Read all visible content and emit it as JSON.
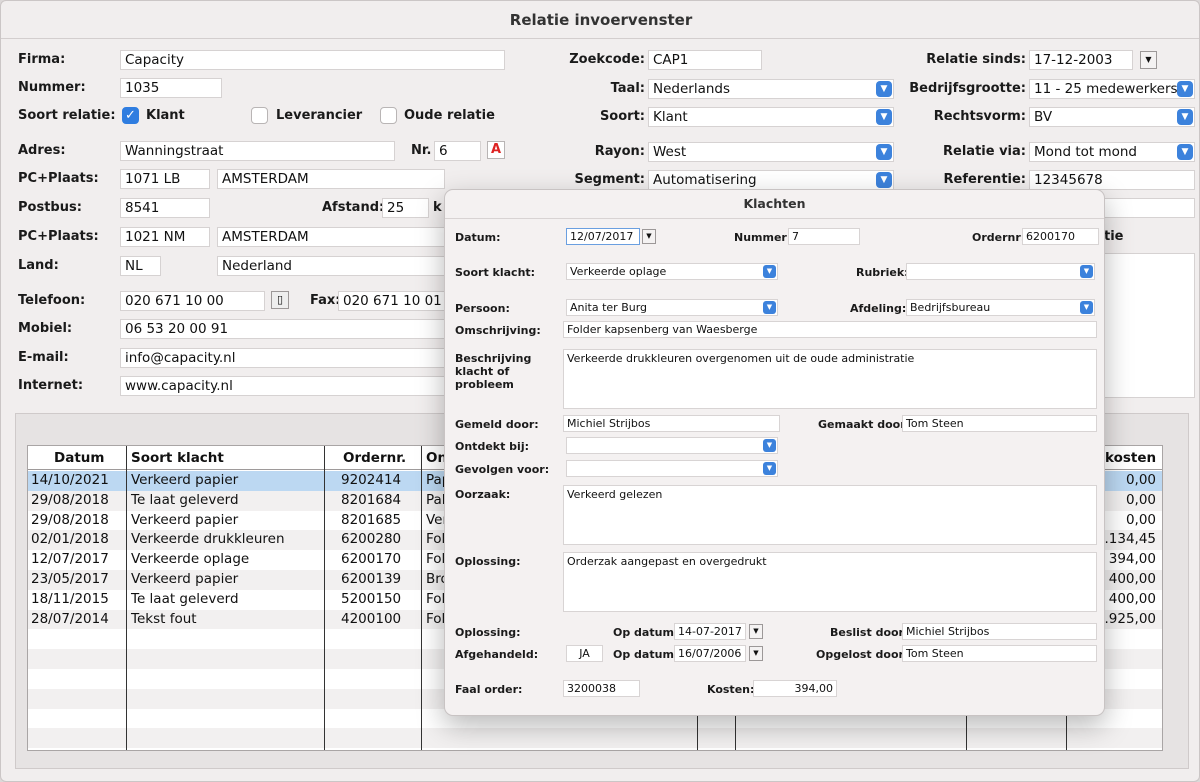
{
  "window": {
    "title": "Relatie invoervenster"
  },
  "form": {
    "firma_label": "Firma:",
    "firma": "Capacity",
    "nummer_label": "Nummer:",
    "nummer": "1035",
    "soort_relatie_label": "Soort relatie:",
    "klant_label": "Klant",
    "leverancier_label": "Leverancier",
    "oude_relatie_label": "Oude relatie",
    "adres_label": "Adres:",
    "adres": "Wanningstraat",
    "nr_label": "Nr.",
    "nr": "6",
    "pc_plaats_label": "PC+Plaats:",
    "pc1": "1071 LB",
    "plaats1": "AMSTERDAM",
    "postbus_label": "Postbus:",
    "postbus": "8541",
    "afstand_label": "Afstand:",
    "afstand": "25",
    "afstand_unit": "k",
    "pc2": "1021 NM",
    "plaats2": "AMSTERDAM",
    "land_label": "Land:",
    "land_code": "NL",
    "land": "Nederland",
    "telefoon_label": "Telefoon:",
    "telefoon": "020 671 10 00",
    "fax_label": "Fax:",
    "fax": "020 671 10 01",
    "mobiel_label": "Mobiel:",
    "mobiel": "06 53 20 00 91",
    "email_label": "E-mail:",
    "email": "info@capacity.nl",
    "internet_label": "Internet:",
    "internet": "www.capacity.nl",
    "zoekcode_label": "Zoekcode:",
    "zoekcode": "CAP1",
    "taal_label": "Taal:",
    "taal": "Nederlands",
    "soort_label": "Soort:",
    "soort": "Klant",
    "rayon_label": "Rayon:",
    "rayon": "West",
    "segment_label": "Segment:",
    "segment": "Automatisering",
    "relatie_sinds_label": "Relatie sinds:",
    "relatie_sinds": "17-12-2003",
    "bedrijfsgrootte_label": "Bedrijfsgrootte:",
    "bedrijfsgrootte": "11 - 25 medewerkers",
    "rechtsvorm_label": "Rechtsvorm:",
    "rechtsvorm": "BV",
    "relatie_via_label": "Relatie via:",
    "relatie_via": "Mond tot mond",
    "referentie_label": "Referentie:",
    "referentie": "12345678",
    "partial_label": "tie"
  },
  "table": {
    "headers": {
      "datum": "Datum",
      "soort": "Soort klacht",
      "ordernr": "Ordernr.",
      "on": "On",
      "kosten": "kosten"
    },
    "rows": [
      {
        "datum": "14/10/2021",
        "soort": "Verkeerd papier",
        "ordernr": "9202414",
        "on": "Pap",
        "kosten": "0,00"
      },
      {
        "datum": "29/08/2018",
        "soort": "Te laat geleverd",
        "ordernr": "8201684",
        "on": "Pal",
        "kosten": "0,00"
      },
      {
        "datum": "29/08/2018",
        "soort": "Verkeerd papier",
        "ordernr": "8201685",
        "on": "Ver",
        "kosten": "0,00"
      },
      {
        "datum": "02/01/2018",
        "soort": "Verkeerde drukkleuren",
        "ordernr": "6200280",
        "on": "Fol",
        "kosten": ".134,45"
      },
      {
        "datum": "12/07/2017",
        "soort": "Verkeerde oplage",
        "ordernr": "6200170",
        "on": "Fol",
        "kosten": "394,00"
      },
      {
        "datum": "23/05/2017",
        "soort": "Verkeerd papier",
        "ordernr": "6200139",
        "on": "Bro",
        "kosten": "400,00"
      },
      {
        "datum": "18/11/2015",
        "soort": "Te laat geleverd",
        "ordernr": "5200150",
        "on": "Fol",
        "kosten": "400,00"
      },
      {
        "datum": "28/07/2014",
        "soort": "Tekst fout",
        "ordernr": "4200100",
        "on": "Fol",
        "kosten": ".925,00"
      }
    ]
  },
  "klachten": {
    "title": "Klachten",
    "datum_label": "Datum:",
    "datum": "12/07/2017",
    "nummer_label": "Nummer:",
    "nummer": "7",
    "ordernr_label": "Ordernr:",
    "ordernr": "6200170",
    "soort_label": "Soort klacht:",
    "soort": "Verkeerde oplage",
    "rubriek_label": "Rubriek:",
    "rubriek": "",
    "persoon_label": "Persoon:",
    "persoon": "Anita ter Burg",
    "afdeling_label": "Afdeling:",
    "afdeling": "Bedrijfsbureau",
    "omschrijving_label": "Omschrijving:",
    "omschrijving": "Folder kapsenberg van Waesberge",
    "beschrijving_label": "Beschrijving klacht of probleem",
    "beschrijving": "Verkeerde drukkleuren overgenomen uit de oude administratie",
    "gemeld_label": "Gemeld door:",
    "gemeld": "Michiel Strijbos",
    "gemaakt_label": "Gemaakt door:",
    "gemaakt": "Tom Steen",
    "ontdekt_label": "Ontdekt bij:",
    "ontdekt": "",
    "gevolgen_label": "Gevolgen voor:",
    "gevolgen": "",
    "oorzaak_label": "Oorzaak:",
    "oorzaak": "Verkeerd gelezen",
    "oplossing_label": "Oplossing:",
    "oplossing": "Orderzak aangepast en overgedrukt",
    "oplossing2_label": "Oplossing:",
    "op_datum_label": "Op datum:",
    "op_datum1": "14-07-2017",
    "beslist_label": "Beslist door:",
    "beslist": "Michiel Strijbos",
    "afgehandeld_label": "Afgehandeld:",
    "afgehandeld": "JA",
    "op_datum2": "16/07/2006",
    "opgelost_label": "Opgelost door:",
    "opgelost": "Tom Steen",
    "faal_label": "Faal order:",
    "faal": "3200038",
    "kosten_label": "Kosten:",
    "kosten": "394,00"
  }
}
